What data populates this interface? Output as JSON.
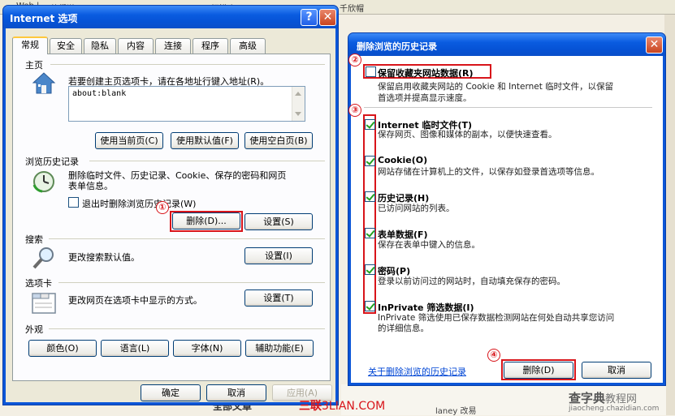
{
  "background": {
    "fragments": [
      "Web |",
      "他们说",
      "探渮个",
      "千欣帽"
    ],
    "bottom_name": "laney 改易",
    "bottom_text": "全部文章"
  },
  "internet_options": {
    "title": "Internet 选项",
    "help_glyph": "?",
    "close_glyph": "✕",
    "tabs": [
      "常规",
      "安全",
      "隐私",
      "内容",
      "连接",
      "程序",
      "高级"
    ],
    "home": {
      "group": "主页",
      "desc": "若要创建主页选项卡，请在各地址行键入地址(R)。",
      "address": "about:blank",
      "btn_current": "使用当前页(C)",
      "btn_default": "使用默认值(F)",
      "btn_blank": "使用空白页(B)"
    },
    "history": {
      "group": "浏览历史记录",
      "desc_line1": "删除临时文件、历史记录、Cookie、保存的密码和网页",
      "desc_line2": "表单信息。",
      "checkbox_label": "退出时删除浏览历史记录(W)",
      "btn_delete": "删除(D)...",
      "btn_settings": "设置(S)"
    },
    "search": {
      "group": "搜索",
      "desc": "更改搜索默认值。",
      "btn_settings": "设置(I)"
    },
    "tabs_group": {
      "group": "选项卡",
      "desc": "更改网页在选项卡中显示的方式。",
      "btn_settings": "设置(T)"
    },
    "appearance": {
      "group": "外观",
      "btn_colors": "颜色(O)",
      "btn_languages": "语言(L)",
      "btn_fonts": "字体(N)",
      "btn_accessibility": "辅助功能(E)"
    },
    "btn_ok": "确定",
    "btn_cancel": "取消",
    "btn_apply": "应用(A)"
  },
  "delete_history": {
    "title": "删除浏览的历史记录",
    "close_glyph": "✕",
    "items": [
      {
        "title": "保留收藏夹网站数据(R)",
        "desc1": "保留启用收藏夹网站的 Cookie 和 Internet 临时文件，以保留",
        "desc2": "首选项并提高显示速度。",
        "checked": false
      },
      {
        "title": "Internet 临时文件(T)",
        "desc1": "保存网页、图像和媒体的副本，以便快速查看。",
        "desc2": "",
        "checked": true
      },
      {
        "title": "Cookie(O)",
        "desc1": "网站存储在计算机上的文件，以保存如登录首选项等信息。",
        "desc2": "",
        "checked": true
      },
      {
        "title": "历史记录(H)",
        "desc1": "已访问网站的列表。",
        "desc2": "",
        "checked": true
      },
      {
        "title": "表单数据(F)",
        "desc1": "保存在表单中键入的信息。",
        "desc2": "",
        "checked": true
      },
      {
        "title": "密码(P)",
        "desc1": "登录以前访问过的网站时，自动填充保存的密码。",
        "desc2": "",
        "checked": true
      },
      {
        "title": "InPrivate 筛选数据(I)",
        "desc1": "InPrivate 筛选使用已保存数据检测网站在何处自动共享您访问",
        "desc2": "的详细信息。",
        "checked": true
      }
    ],
    "link": "关于删除浏览的历史记录",
    "btn_delete": "删除(D)",
    "btn_cancel": "取消"
  },
  "annotations": [
    "①",
    "②",
    "③",
    "④"
  ],
  "watermarks": {
    "brand_a": "三联",
    "brand_b": "3LIAN.COM",
    "site_name": "查字典",
    "site_suffix": "教程网",
    "site_url": "jiaocheng.chazidian.com"
  },
  "colors": {
    "annotation": "#d8141a",
    "title_bar": "#0a5ce0",
    "link": "#0046d5"
  }
}
